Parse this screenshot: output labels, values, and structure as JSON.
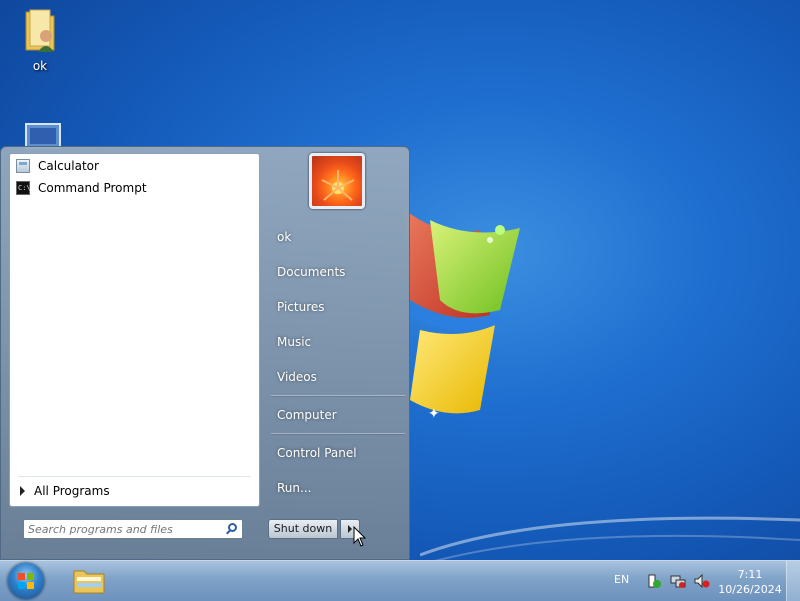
{
  "desktop": {
    "icons": [
      {
        "label": "ok",
        "icon": "user-folder-icon"
      },
      {
        "label": "",
        "icon": "computer-icon"
      }
    ]
  },
  "start_menu": {
    "programs": [
      {
        "label": "Calculator",
        "icon": "calculator-icon"
      },
      {
        "label": "Command Prompt",
        "icon": "command-prompt-icon"
      }
    ],
    "all_programs": "All Programs",
    "search_placeholder": "Search programs and files",
    "user_picture": "flower-user-picture",
    "right_items": [
      "ok",
      "Documents",
      "Pictures",
      "Music",
      "Videos",
      "Computer",
      "Control Panel",
      "Run..."
    ],
    "shutdown_label": "Shut down"
  },
  "taskbar": {
    "pinned": [
      "start-orb",
      "windows-explorer-icon"
    ],
    "language": "EN",
    "tray_icons": [
      "action-center-icon",
      "network-icon",
      "volume-muted-icon"
    ],
    "clock_time": "7:11",
    "clock_date": "10/26/2024"
  },
  "colors": {
    "desktop_bg": "#1f6fd0",
    "taskbar_bg": "#7fa2c8",
    "start_menu_right_pane": "#8ea4ba"
  }
}
